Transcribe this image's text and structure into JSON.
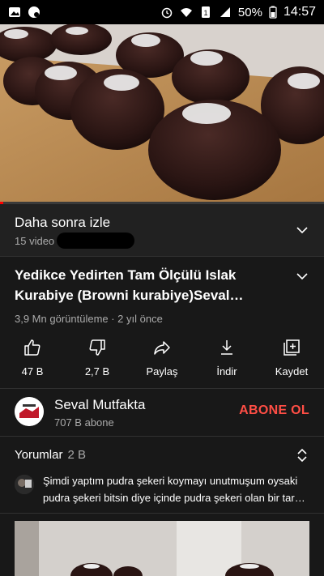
{
  "status_bar": {
    "battery": "50%",
    "time": "14:57"
  },
  "video": {
    "progress_fraction": 0.01
  },
  "playlist": {
    "title": "Daha sonra izle",
    "count": "15 video"
  },
  "video_info": {
    "title": "Yedikce Yedirten Tam Ölçülü Islak Kurabiye (Browni kurabiye)Seval…",
    "meta": "3,9 Mn görüntüleme · 2 yıl önce"
  },
  "actions": [
    {
      "label": "47 B",
      "icon": "thumbs-up-icon"
    },
    {
      "label": "2,7 B",
      "icon": "thumbs-down-icon"
    },
    {
      "label": "Paylaş",
      "icon": "share-icon"
    },
    {
      "label": "İndir",
      "icon": "download-icon"
    },
    {
      "label": "Kaydet",
      "icon": "save-to-playlist-icon"
    }
  ],
  "channel": {
    "name": "Seval Mutfakta",
    "subscribers": "707 B abone",
    "subscribe_label": "ABONE OL",
    "subscribe_color": "#ff4e45"
  },
  "comments": {
    "heading": "Yorumlar",
    "count": "2 B",
    "top_comment": "Şimdi yaptım pudra şekeri koymayı unutmuşum oysaki pudra şekeri bitsin diye içinde pudra şekeri olan bir tar…"
  }
}
